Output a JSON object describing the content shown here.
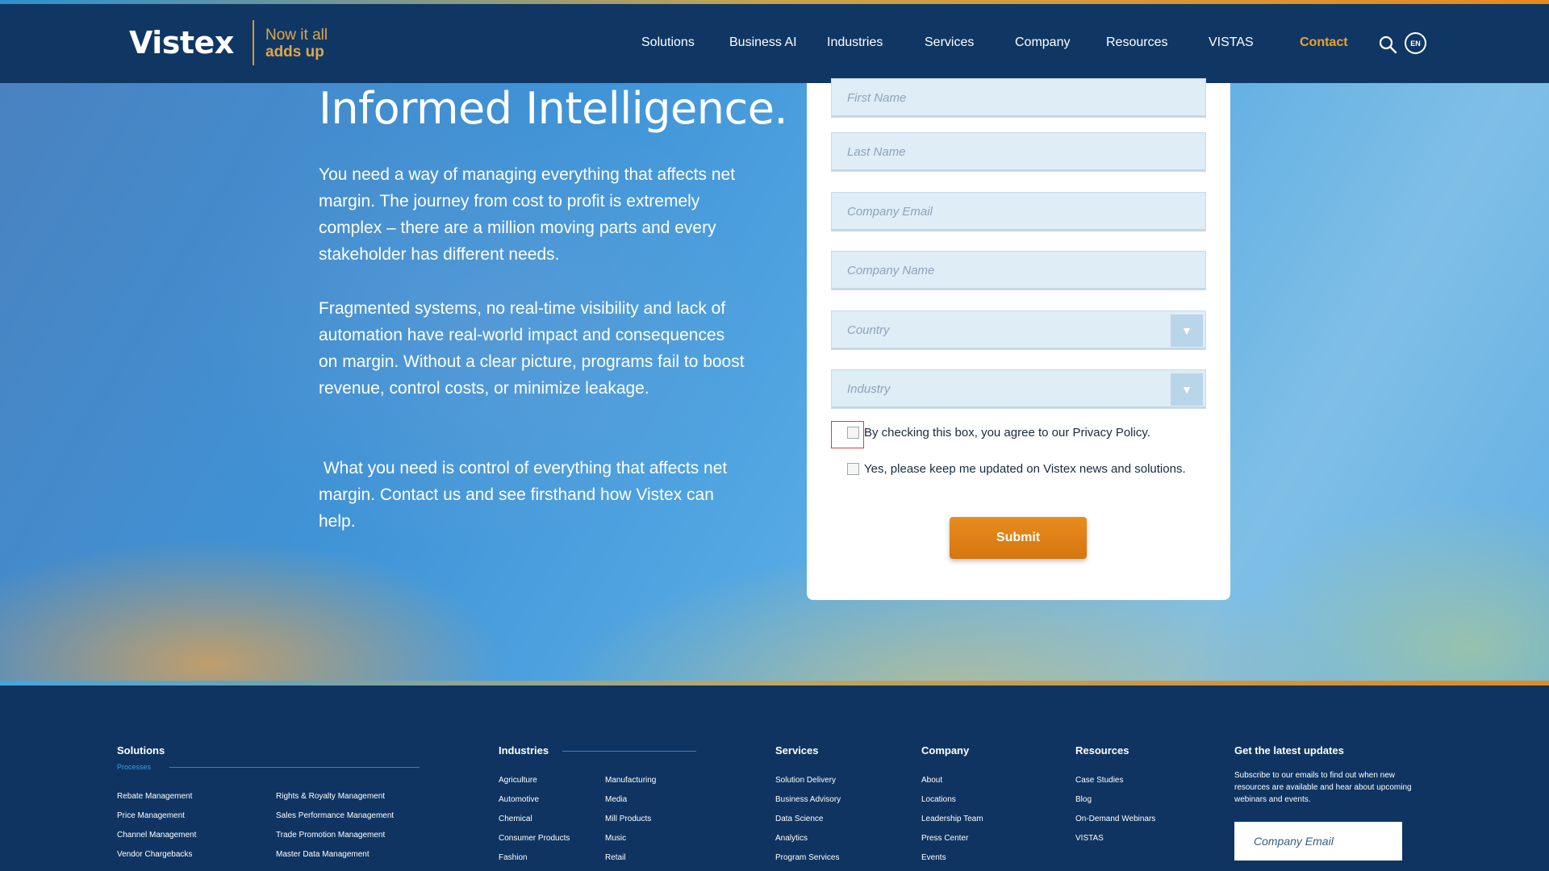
{
  "header": {
    "logo": "Vistex",
    "tagline_line1": "Now it all",
    "tagline_line2": "adds up",
    "nav": [
      "Solutions",
      "Business AI",
      "Industries",
      "Services",
      "Company",
      "Resources",
      "VISTAS"
    ],
    "contact": "Contact",
    "language": "EN"
  },
  "hero": {
    "headline": "Informed Intelligence.",
    "paragraphs": [
      "You need a way of managing everything that affects net margin. The journey from cost to profit is extremely complex – there are a million moving parts and every stakeholder has different needs.",
      "Fragmented systems, no real-time visibility and lack of automation have real-world impact and consequences on margin. Without a clear picture, programs fail to boost revenue, control costs, or minimize leakage.",
      " What you need is control of everything that affects net margin. Contact us and see firsthand how Vistex can help."
    ]
  },
  "form": {
    "first_name": "First Name",
    "last_name": "Last Name",
    "company_email": "Company Email",
    "company_name": "Company Name",
    "country": "Country",
    "industry": "Industry",
    "privacy_label": "By checking this box, you agree to our Privacy Policy.",
    "updates_label": "Yes, please keep me updated on Vistex news and solutions.",
    "submit": "Submit"
  },
  "footer": {
    "solutions": {
      "title": "Solutions",
      "sub": "Processes",
      "col1": [
        "Rebate Management",
        "Price Management",
        "Channel Management",
        "Vendor Chargebacks"
      ],
      "col2": [
        "Rights & Royalty Management",
        "Sales Performance Management",
        "Trade Promotion Management",
        "Master Data Management"
      ]
    },
    "industries": {
      "title": "Industries",
      "col1": [
        "Agriculture",
        "Automotive",
        "Chemical",
        "Consumer Products",
        "Fashion"
      ],
      "col2": [
        "Manufacturing",
        "Media",
        "Mill Products",
        "Music",
        "Retail"
      ]
    },
    "services": {
      "title": "Services",
      "items": [
        "Solution Delivery",
        "Business Advisory",
        "Data Science",
        "Analytics",
        "Program Services"
      ]
    },
    "company": {
      "title": "Company",
      "items": [
        "About",
        "Locations",
        "Leadership Team",
        "Press Center",
        "Events"
      ]
    },
    "resources": {
      "title": "Resources",
      "items": [
        "Case Studies",
        "Blog",
        "On-Demand Webinars",
        "VISTAS"
      ]
    },
    "updates": {
      "title": "Get the latest updates",
      "description": "Subscribe to our emails to find out when new resources are available and hear about upcoming webinars and events.",
      "email_placeholder": "Company Email"
    }
  }
}
